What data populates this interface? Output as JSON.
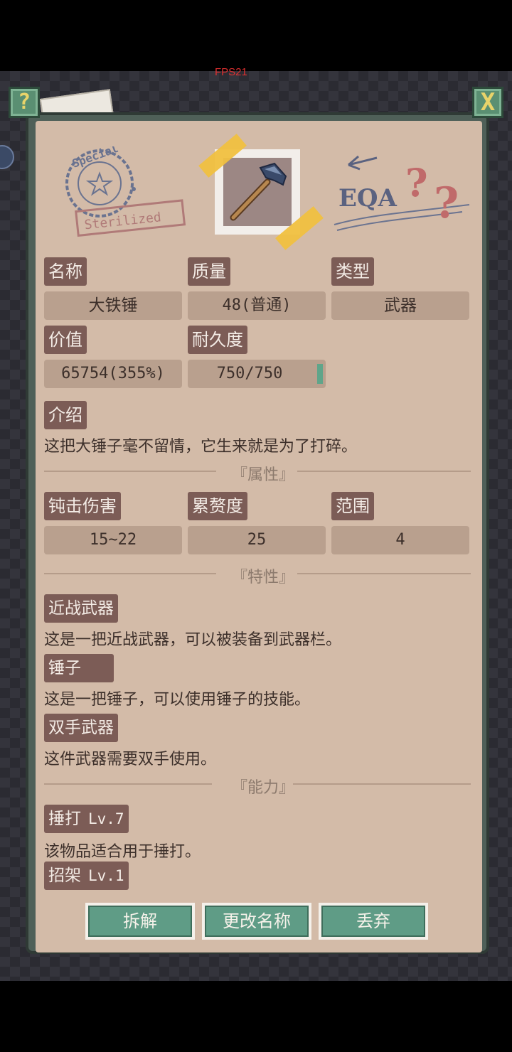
{
  "hud": {
    "fps": "FPS21",
    "help_icon": "?",
    "close_icon": "X"
  },
  "header": {
    "stamp_text": "Special",
    "stamp_banner": "Sterilized",
    "scribble_text": "EQA",
    "item_icon": "hammer-icon"
  },
  "info": {
    "name_label": "名称",
    "name_value": "大铁锤",
    "quality_label": "质量",
    "quality_value": "48(普通)",
    "type_label": "类型",
    "type_value": "武器",
    "price_label": "价值",
    "price_value": "65754(355%)",
    "durability_label": "耐久度",
    "durability_value": "750/750",
    "durability_fraction": 1.0,
    "intro_label": "介绍",
    "intro_text": "这把大锤子毫不留情，它生来就是为了打碎。"
  },
  "attributes": {
    "title": "『属性』",
    "blunt_label": "钝击伤害",
    "blunt_value": "15~22",
    "fatigue_label": "累赘度",
    "fatigue_value": "25",
    "range_label": "范围",
    "range_value": "4"
  },
  "traits": {
    "title": "『特性』",
    "items": [
      {
        "label": "近战武器",
        "desc": "这是一把近战武器，可以被装备到武器栏。"
      },
      {
        "label": "锤子",
        "desc": "这是一把锤子，可以使用锤子的技能。"
      },
      {
        "label": "双手武器",
        "desc": "这件武器需要双手使用。"
      }
    ]
  },
  "abilities": {
    "title": "『能力』",
    "items": [
      {
        "label": "捶打",
        "level": "Lv.7",
        "desc": "该物品适合用于捶打。"
      },
      {
        "label": "招架",
        "level": "Lv.1",
        "desc": ""
      }
    ]
  },
  "actions": {
    "dismantle": "拆解",
    "rename": "更改名称",
    "discard": "丢弃"
  },
  "colors": {
    "panel": "#d3bba8",
    "label_bg": "#7c5c56",
    "value_bg": "#b9a08e",
    "button": "#5f9c86",
    "accent_yellow": "#e8d36a"
  }
}
